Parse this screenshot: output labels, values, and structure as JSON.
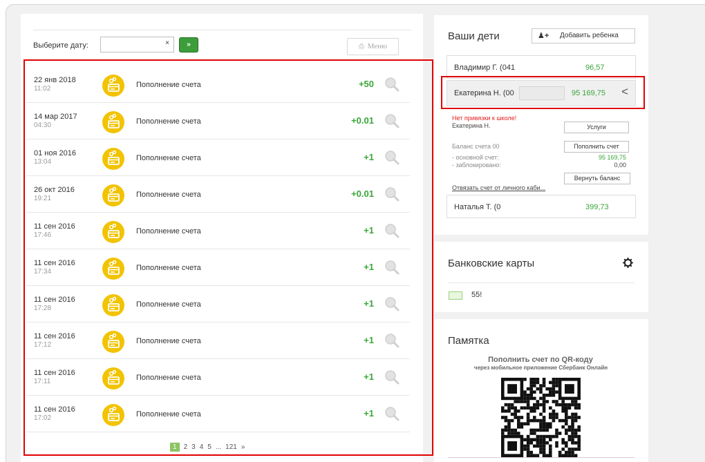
{
  "filter": {
    "date_label": "Выберите дату:",
    "date_value": "",
    "clear_glyph": "×",
    "go_label": "»",
    "menu_label": "Меню"
  },
  "transactions": [
    {
      "date": "22 янв 2018",
      "time": "11:02",
      "description": "Пополнение счета",
      "amount": "+50"
    },
    {
      "date": "14 мар 2017",
      "time": "04:30",
      "description": "Пополнение счета",
      "amount": "+0.01"
    },
    {
      "date": "01 ноя 2016",
      "time": "13:04",
      "description": "Пополнение счета",
      "amount": "+1"
    },
    {
      "date": "26 окт 2016",
      "time": "19:21",
      "description": "Пополнение счета",
      "amount": "+0.01"
    },
    {
      "date": "11 сен 2016",
      "time": "17:46",
      "description": "Пополнение счета",
      "amount": "+1"
    },
    {
      "date": "11 сен 2016",
      "time": "17:34",
      "description": "Пополнение счета",
      "amount": "+1"
    },
    {
      "date": "11 сен 2016",
      "time": "17:28",
      "description": "Пополнение счета",
      "amount": "+1"
    },
    {
      "date": "11 сен 2016",
      "time": "17:12",
      "description": "Пополнение счета",
      "amount": "+1"
    },
    {
      "date": "11 сен 2016",
      "time": "17:11",
      "description": "Пополнение счета",
      "amount": "+1"
    },
    {
      "date": "11 сен 2016",
      "time": "17:02",
      "description": "Пополнение счета",
      "amount": "+1"
    }
  ],
  "pagination": {
    "pages": [
      "1",
      "2",
      "3",
      "4",
      "5",
      "...",
      "121",
      "»"
    ],
    "active": "1"
  },
  "kids": {
    "title": "Ваши дети",
    "add_button": "Добавить ребенка",
    "list": [
      {
        "name": "Владимир Г. (041",
        "balance": "96,57"
      },
      {
        "name": "Екатерина Н. (00",
        "balance": "95 169,75"
      },
      {
        "name": "Наталья Т. (0",
        "balance": "399,73"
      }
    ],
    "selected": {
      "warning": "Нет привязки к школе!",
      "name": "Екатерина Н.",
      "services_button": "Услуги",
      "balance_label": "Баланс счета 00",
      "topup_button": "Пополнить счет",
      "main_account_label": "- основной счет:",
      "main_account_value": "95 169,75",
      "blocked_label": "- заблокировано:",
      "blocked_value": "0,00",
      "return_button": "Вернуть баланс",
      "unlink_link": "Отвязать счет от личного каби..."
    }
  },
  "bank_cards": {
    "title": "Банковские карты",
    "card_number": "55!"
  },
  "memo": {
    "title": "Памятка",
    "qr_title": "Пополнить счет по QR-коду",
    "qr_subtitle": "через мобильное приложение Сбербанк Онлайн"
  },
  "colors": {
    "accent_green": "#3aa53a",
    "highlight_red": "#e00000",
    "coin_yellow": "#f2c300"
  }
}
